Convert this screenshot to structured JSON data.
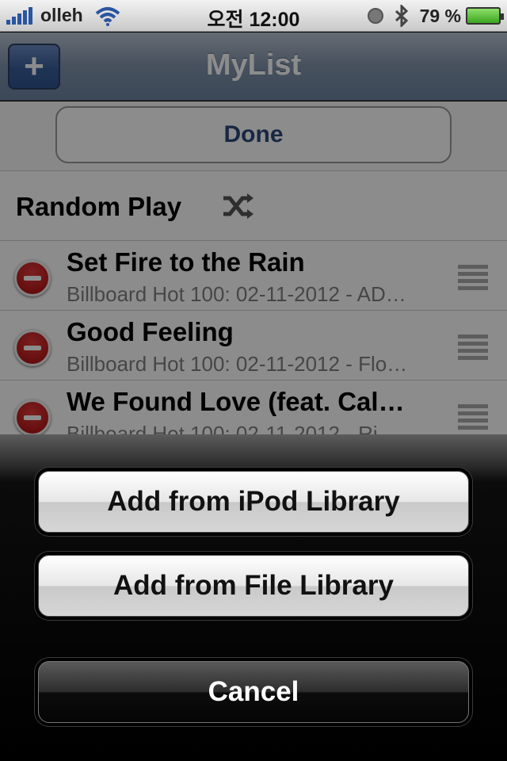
{
  "status_bar": {
    "carrier": "olleh",
    "time": "오전 12:00",
    "battery_percent": "79 %"
  },
  "nav": {
    "add_label": "+",
    "title": "MyList"
  },
  "edit": {
    "done_label": "Done"
  },
  "random_play": {
    "label": "Random Play",
    "icon": "shuffle-icon"
  },
  "songs": [
    {
      "title": "Set Fire to the Rain",
      "subtitle": "Billboard Hot 100: 02-11-2012 - AD…"
    },
    {
      "title": "Good Feeling",
      "subtitle": "Billboard Hot 100: 02-11-2012 - Flo…"
    },
    {
      "title": "We Found Love (feat. Cal…",
      "subtitle": "Billboard Hot 100: 02-11-2012 - Ri…"
    }
  ],
  "action_sheet": {
    "ipod_label": "Add from iPod Library",
    "file_label": "Add from File Library",
    "cancel_label": "Cancel"
  },
  "colors": {
    "nav_bar": "#7e90a8",
    "delete_red": "#c01818",
    "done_text": "#2d4a7a"
  }
}
